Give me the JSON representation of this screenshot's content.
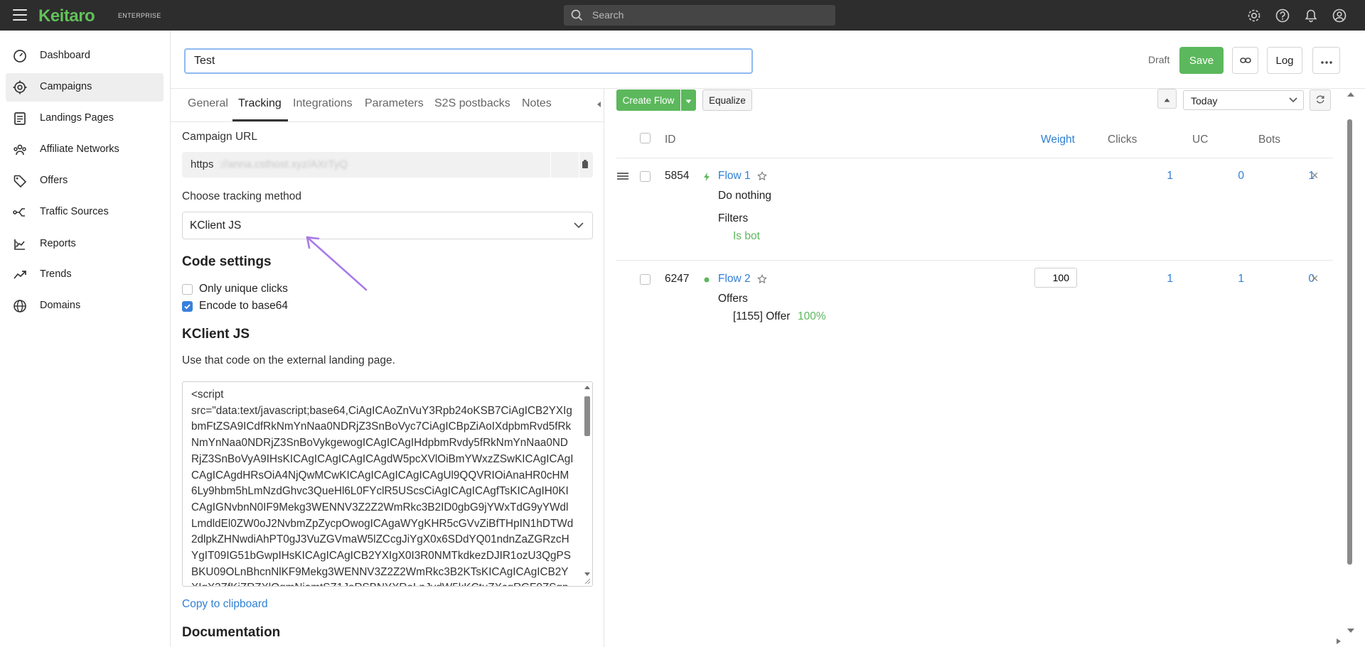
{
  "topbar": {
    "logo": "Keitaro",
    "logo_tag": "ENTERPRISE",
    "search_placeholder": "Search"
  },
  "sidebar": {
    "items": [
      {
        "label": "Dashboard",
        "icon": "dashboard-icon"
      },
      {
        "label": "Campaigns",
        "icon": "target-icon",
        "active": true
      },
      {
        "label": "Landings Pages",
        "icon": "page-icon"
      },
      {
        "label": "Affiliate Networks",
        "icon": "users-icon"
      },
      {
        "label": "Offers",
        "icon": "tag-icon"
      },
      {
        "label": "Traffic Sources",
        "icon": "route-icon"
      },
      {
        "label": "Reports",
        "icon": "report-icon",
        "has_submenu": true
      },
      {
        "label": "Trends",
        "icon": "trend-icon"
      },
      {
        "label": "Domains",
        "icon": "globe-icon"
      }
    ]
  },
  "header": {
    "campaign_name": "Test",
    "status": "Draft",
    "save_label": "Save",
    "log_label": "Log"
  },
  "tabs": [
    "General",
    "Tracking",
    "Integrations",
    "Parameters",
    "S2S postbacks",
    "Notes"
  ],
  "tracking": {
    "campaign_url_label": "Campaign URL",
    "url_protocol": "https",
    "url_rest": "://anna.csthost.xyz/AXrTyQ",
    "method_label": "Choose tracking method",
    "method_value": "KClient JS",
    "code_settings_title": "Code settings",
    "only_unique_label": "Only unique clicks",
    "encode_label": "Encode to base64",
    "kclient_title": "KClient JS",
    "kclient_desc": "Use that code on the external landing page.",
    "code": "<script\nsrc=\"data:text/javascript;base64,CiAgICAoZnVuY3Rpb24oKSB7CiAgICB2YXIgbmFtZSA9ICdfRkNmYnNaa0NDRjZ3SnBoVyc7CiAgICBpZiAoIXdpbmRvd5fRkNmYnNaa0NDRjZ3SnBoVykgewogICAgICAgIHdpbmRvdy5fRkNmYnNaa0NDRjZ3SnBoVyA9IHsKICAgICAgICAgICAgdW5pcXVlOiBmYWxzZSwKICAgICAgICAgICAgdHRsOiA4NjQwMCwKICAgICAgICAgICAgUl9QQVRIOiAnaHR0cHM6Ly9hbm5hLmNzdGhvc3QueHl6L0FYclR5UScsCiAgICAgICAgfTsKICAgIH0KICAgIGNvbnN0IF9Mekg3WENNV3Z2Z2WmRkc3B2ID0gbG9jYWxTdG9yYWdlLmdldEl0ZW0oJ2NvbmZpZycpOwogICAgaWYgKHR5cGVvZiBfTHpIN1hDTWd2dlpkZHNwdiAhPT0gJ3VuZGVmaW5lZCcgJiYgX0x6SDdYQ01ndnZaZGRzcHYgIT09IG51bGwpIHsKICAgICAgICB2YXIgX0I3R0NMTkdkezDJIR1ozU3QgPSBKU09OLnBhcnNlKF9Mekg3WENNV3Z2Z2WmRkc3B2KTsKICAgICAgICB2YXIgX3ZfKiZRZXlQgmNjamtSZ1JoRSBNYXRoLnJvdW5kKCtuZXcgRGF0ZSgpLzEwMDApOwogICAgICAgIGlmIChfQjdHQ0xOR2RzN0h..."
  },
  "footer": {
    "copy_link": "Copy to clipboard",
    "documentation": "Documentation"
  },
  "flows_toolbar": {
    "create_flow": "Create Flow",
    "equalize": "Equalize",
    "period": "Today"
  },
  "flows_table": {
    "columns": [
      "ID",
      "Weight",
      "Clicks",
      "UC",
      "Bots"
    ],
    "rows": [
      {
        "id": "5854",
        "name": "Flow 1",
        "schema": "Do nothing",
        "section_label": "Filters",
        "section_value": "Is bot",
        "clicks": "1",
        "uc": "0",
        "bots": "1",
        "weight": ""
      },
      {
        "id": "6247",
        "name": "Flow 2",
        "section_label": "Offers",
        "offer_name": "[1155] Offer",
        "offer_share": "100%",
        "clicks": "1",
        "uc": "1",
        "bots": "0",
        "weight": "100"
      }
    ]
  },
  "colors": {
    "brand_green": "#63c05a",
    "primary_blue": "#2f7fd5",
    "annotation_arrow": "#a97ae8"
  }
}
